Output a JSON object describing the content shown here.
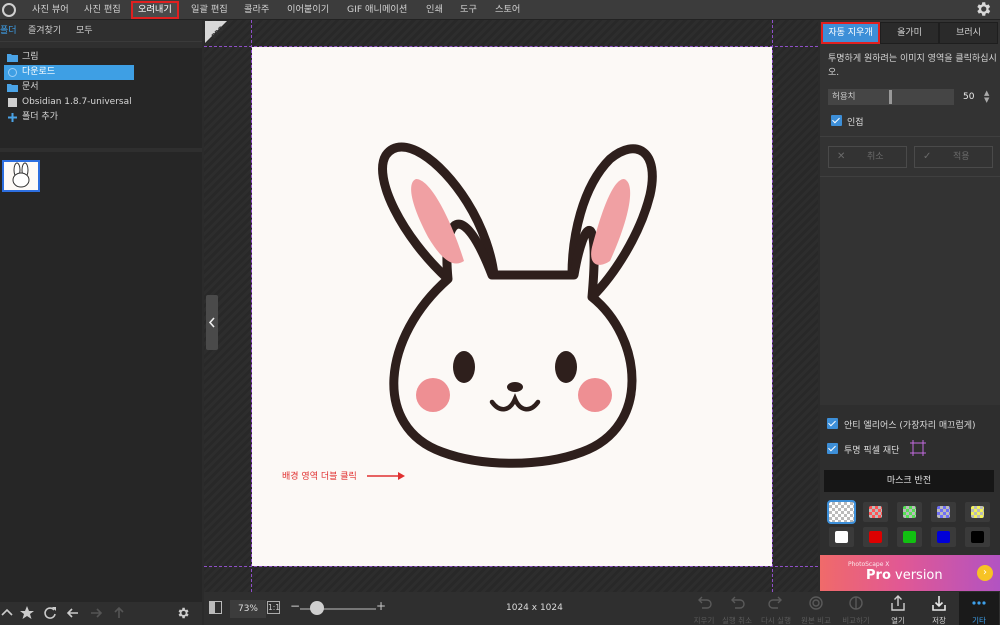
{
  "top_menu": {
    "items": [
      "사진 뷰어",
      "사진 편집",
      "오려내기",
      "일괄 편집",
      "콜라주",
      "이어붙이기",
      "GIF 애니메이션",
      "인쇄",
      "도구",
      "스토어"
    ],
    "active": "오려내기"
  },
  "left_panel": {
    "tabs": [
      "폴더",
      "즐겨찾기",
      "모두"
    ],
    "active_tab": "폴더",
    "tree": [
      {
        "label": "그림",
        "icon": "folder-icon"
      },
      {
        "label": "다운로드",
        "icon": "download-icon",
        "selected": true
      },
      {
        "label": "문서",
        "icon": "folder-icon"
      },
      {
        "label": "Obsidian 1.8.7-universal",
        "icon": "disk-icon"
      },
      {
        "label": "폴더 추가",
        "icon": "plus-icon"
      }
    ]
  },
  "canvas": {
    "annotation": "배경 영역 더블 클릭",
    "badge": "PRO"
  },
  "bottom_bar": {
    "zoom": "73%",
    "actual_size": "1:1",
    "image_size": "1024 x 1024"
  },
  "right_panel": {
    "tabs": [
      "자동 지우개",
      "올가미",
      "브러시"
    ],
    "active_tab": "자동 지우개",
    "instruction": "투명하게 원하려는 이미지 영역을 클릭하십시오.",
    "tolerance_label": "허용치",
    "tolerance_value": "50",
    "adjacent_label": "인접",
    "cancel_label": "취소",
    "apply_label": "적용",
    "antialias_label": "안티 엘리어스 (가장자리 매끄럽게)",
    "crop_label": "투명 픽셀 재단",
    "invert_mask_label": "마스크 반전",
    "swatches": [
      {
        "name": "checker-gray",
        "color": "#bbbbbb",
        "selected": true
      },
      {
        "name": "checker-red",
        "color": "#ff5555"
      },
      {
        "name": "checker-green",
        "color": "#55e055"
      },
      {
        "name": "checker-blue",
        "color": "#6f6ff5"
      },
      {
        "name": "checker-yellow",
        "color": "#f2f25a"
      },
      {
        "name": "white",
        "color": "#ffffff"
      },
      {
        "name": "red",
        "color": "#dd0000"
      },
      {
        "name": "green",
        "color": "#11c011"
      },
      {
        "name": "blue",
        "color": "#0000d8"
      },
      {
        "name": "black",
        "color": "#000000"
      }
    ]
  },
  "promo": {
    "small": "PhotoScape X",
    "big_a": "Pro",
    "big_b": " version"
  },
  "actions": [
    {
      "label": "지우기",
      "disabled": true
    },
    {
      "label": "실행 취소",
      "disabled": true
    },
    {
      "label": "다시 실행",
      "disabled": true
    },
    {
      "label": "원본 비교",
      "disabled": true
    },
    {
      "label": "비교하기",
      "disabled": true
    },
    {
      "label": "열기"
    },
    {
      "label": "저장"
    },
    {
      "label": "기타",
      "active": true
    }
  ],
  "colors": {
    "accent": "#3d8fd8",
    "highlight_border": "#e02020",
    "guide": "#8e4fc8",
    "annotation": "#e03030"
  }
}
